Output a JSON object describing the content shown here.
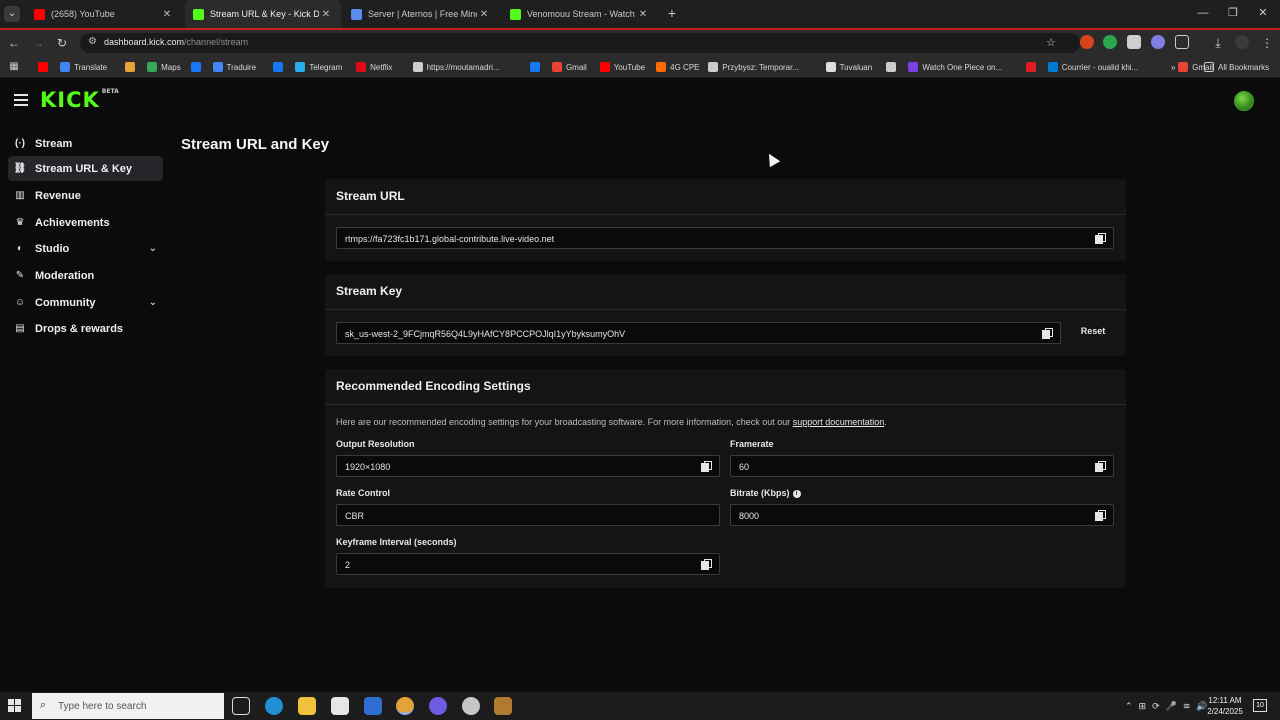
{
  "browser": {
    "tabs": [
      {
        "title": "(2658) YouTube",
        "favicon_color": "#ff0000"
      },
      {
        "title": "Stream URL & Key - Kick Dashb",
        "favicon_color": "#53fc18"
      },
      {
        "title": "Server | Aternos | Free Minecraf",
        "favicon_color": "#5a8dee"
      },
      {
        "title": "Venomouu Stream - Watch Live",
        "favicon_color": "#53fc18"
      }
    ],
    "url_host": "dashboard.kick.com",
    "url_path": "/channel/stream",
    "bookmarks": [
      {
        "label": "",
        "color": "#ff0000"
      },
      {
        "label": "Translate",
        "color": "#4285f4"
      },
      {
        "label": "",
        "color": "#e8a23a"
      },
      {
        "label": "Maps",
        "color": "#34a853"
      },
      {
        "label": "",
        "color": "#1877f2"
      },
      {
        "label": "Traduire",
        "color": "#4285f4"
      },
      {
        "label": "",
        "color": "#1877f2"
      },
      {
        "label": "Telegram",
        "color": "#2aabee"
      },
      {
        "label": "Netflix",
        "color": "#e50914"
      },
      {
        "label": "https://moutamadri...",
        "color": "#cccccc"
      },
      {
        "label": "",
        "color": "#1877f2"
      },
      {
        "label": "Gmail",
        "color": "#ea4335"
      },
      {
        "label": "YouTube",
        "color": "#ff0000"
      },
      {
        "label": "4G CPE",
        "color": "#ff6a00"
      },
      {
        "label": "Przybysz: Temporar...",
        "color": "#cccccc"
      },
      {
        "label": "Tuvaluan",
        "color": "#dddddd"
      },
      {
        "label": "",
        "color": "#cccccc"
      },
      {
        "label": "Watch One Piece on...",
        "color": "#7b3fe4"
      },
      {
        "label": "",
        "color": "#e31b23"
      },
      {
        "label": "Courrier - oualid khi...",
        "color": "#0078d4"
      },
      {
        "label": "Gmail",
        "color": "#ea4335"
      }
    ],
    "all_bookmarks": "All Bookmarks"
  },
  "app": {
    "logo": "KICK",
    "logo_badge": "BETA"
  },
  "sidebar": {
    "items": [
      {
        "label": "Stream",
        "icon": "broadcast-icon",
        "glyph": "((·))"
      },
      {
        "label": "Stream URL & Key",
        "icon": "link-icon",
        "glyph": "🔗"
      },
      {
        "label": "Revenue",
        "icon": "bank-icon",
        "glyph": "▥"
      },
      {
        "label": "Achievements",
        "icon": "trophy-icon",
        "glyph": "🏆"
      },
      {
        "label": "Studio",
        "icon": "palette-icon",
        "glyph": "◐"
      },
      {
        "label": "Moderation",
        "icon": "wrench-icon",
        "glyph": "🔧"
      },
      {
        "label": "Community",
        "icon": "users-icon",
        "glyph": "👥"
      },
      {
        "label": "Drops & rewards",
        "icon": "chart-icon",
        "glyph": "▤"
      }
    ]
  },
  "main": {
    "title": "Stream URL and Key",
    "stream_url": {
      "heading": "Stream URL",
      "value": "rtmps://fa723fc1b171.global-contribute.live-video.net"
    },
    "stream_key": {
      "heading": "Stream Key",
      "value": "sk_us-west-2_9FCjmqR56Q4L9yHAfCY8PCCPOJlqI1yYbyksumyOhV",
      "reset_label": "Reset"
    },
    "encoding": {
      "heading": "Recommended Encoding Settings",
      "description": "Here are our recommended encoding settings for your broadcasting software. For more information, check out our ",
      "link_text": "support documentation",
      "description_end": ".",
      "output_resolution_label": "Output Resolution",
      "output_resolution": "1920×1080",
      "framerate_label": "Framerate",
      "framerate": "60",
      "rate_control_label": "Rate Control",
      "rate_control": "CBR",
      "bitrate_label": "Bitrate (Kbps)",
      "bitrate": "8000",
      "keyframe_label": "Keyframe Interval (seconds)",
      "keyframe": "2"
    }
  },
  "taskbar": {
    "search_placeholder": "Type here to search",
    "time": "12:11 AM",
    "date": "2/24/2025",
    "notification_count": "10"
  }
}
